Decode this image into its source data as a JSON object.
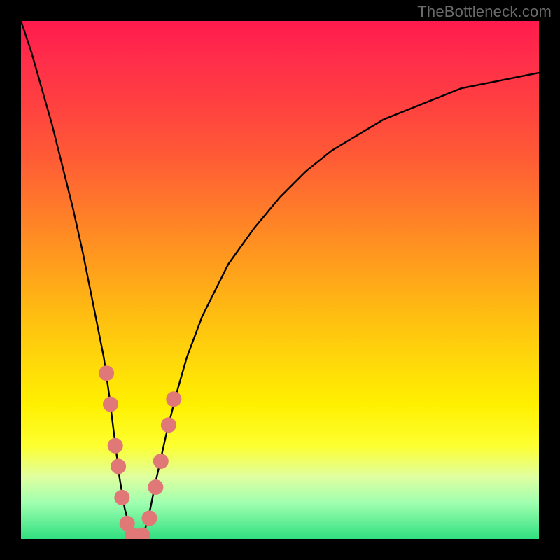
{
  "watermark": {
    "text": "TheBottleneck.com"
  },
  "chart_data": {
    "type": "line",
    "title": "",
    "xlabel": "",
    "ylabel": "",
    "xlim": [
      0,
      100
    ],
    "ylim": [
      0,
      100
    ],
    "series": [
      {
        "name": "bottleneck-curve",
        "x": [
          0,
          2,
          4,
          6,
          8,
          10,
          12,
          14,
          16,
          17,
          18,
          19,
          20,
          21,
          22,
          23,
          24,
          25,
          26,
          28,
          30,
          32,
          35,
          40,
          45,
          50,
          55,
          60,
          65,
          70,
          75,
          80,
          85,
          90,
          95,
          100
        ],
        "values": [
          100,
          94,
          87,
          80,
          72,
          64,
          55,
          45,
          35,
          28,
          20,
          12,
          6,
          2,
          0,
          0,
          2,
          6,
          11,
          20,
          28,
          35,
          43,
          53,
          60,
          66,
          71,
          75,
          78,
          81,
          83,
          85,
          87,
          88,
          89,
          90
        ]
      }
    ],
    "markers": {
      "name": "highlighted-points",
      "color": "#e07878",
      "points": [
        {
          "x": 16.5,
          "y": 32
        },
        {
          "x": 17.3,
          "y": 26
        },
        {
          "x": 18.2,
          "y": 18
        },
        {
          "x": 18.8,
          "y": 14
        },
        {
          "x": 19.5,
          "y": 8
        },
        {
          "x": 20.5,
          "y": 3
        },
        {
          "x": 21.5,
          "y": 0.7
        },
        {
          "x": 22.5,
          "y": 0.5
        },
        {
          "x": 23.5,
          "y": 0.7
        },
        {
          "x": 24.8,
          "y": 4
        },
        {
          "x": 26.0,
          "y": 10
        },
        {
          "x": 27.0,
          "y": 15
        },
        {
          "x": 28.5,
          "y": 22
        },
        {
          "x": 29.5,
          "y": 27
        }
      ]
    },
    "background_gradient": {
      "top": "#ff1a4d",
      "middle": "#ffd90a",
      "bottom": "#30e080"
    }
  }
}
